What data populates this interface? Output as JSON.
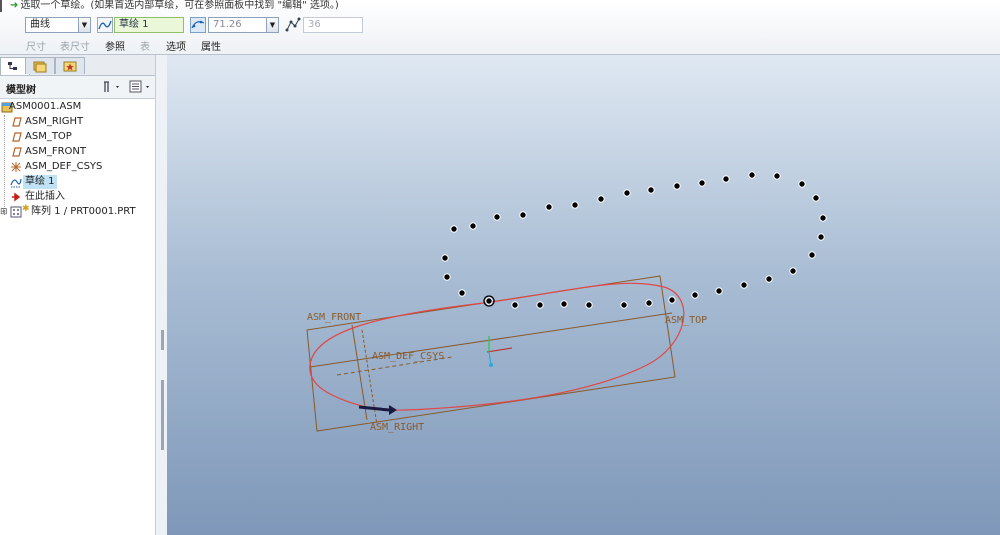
{
  "message": "选取一个草绘。(如果首选内部草绘，可在参照面板中找到 \"编辑\" 选项。)",
  "dashboard": {
    "type_combo": "曲线",
    "sketch_field": "草绘 1",
    "value_combo": "71.26",
    "extra_field": "36",
    "tabs": {
      "size": "尺寸",
      "table_size": "表尺寸",
      "references": "参照",
      "table": "表",
      "options": "选项",
      "properties": "属性"
    }
  },
  "navigator": {
    "title": "模型树",
    "items": [
      {
        "label": "ASM0001.ASM"
      },
      {
        "label": "ASM_RIGHT"
      },
      {
        "label": "ASM_TOP"
      },
      {
        "label": "ASM_FRONT"
      },
      {
        "label": "ASM_DEF_CSYS"
      },
      {
        "label": "草绘 1"
      },
      {
        "label": "在此插入"
      },
      {
        "label": "阵列 1 / PRT0001.PRT"
      }
    ]
  },
  "graphics": {
    "datum_labels": {
      "front": "ASM_FRONT",
      "top": "ASM_TOP",
      "csys": "ASM_DEF_CSYS",
      "right": "ASM_RIGHT"
    }
  },
  "colors": {
    "datum": "#8a5a2a",
    "sketch_curve": "#e04848",
    "pattern_points": "#000000",
    "selection": "#bfe3f5"
  }
}
